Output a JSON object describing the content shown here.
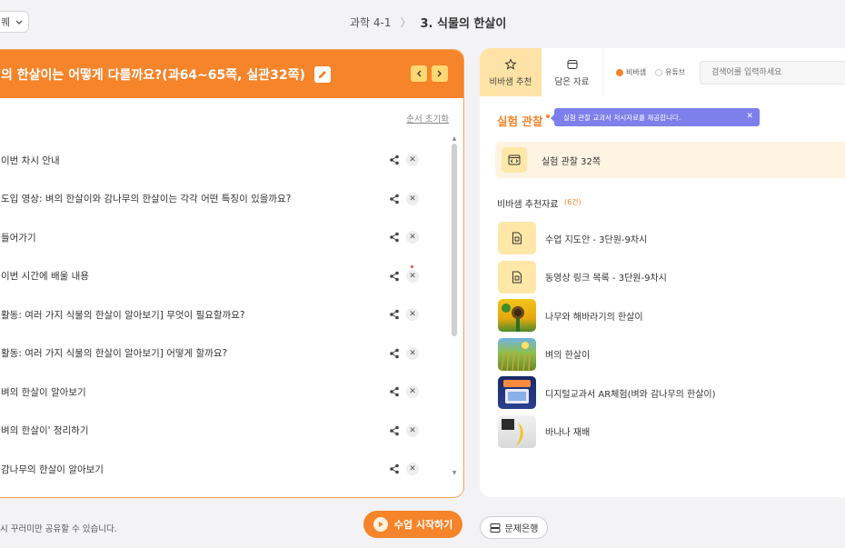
{
  "topbar": {
    "dropdown_label": "퀘",
    "breadcrumb_subject": "과학 4-1",
    "breadcrumb_current": "3. 식물의 한살이"
  },
  "lesson": {
    "title": "의 한살이는 어떻게 다를까요?(과64~65쪽, 실관32쪽)",
    "reset_label": "순서 초기화",
    "items": [
      "이번 차시 안내",
      "도입 영상: 벼의 한살이와 감나무의 한살이는 각각 어떤 특징이 있을까요?",
      "들어가기",
      "이번 시간에 배울 내용",
      "활동: 여러 가지 식물의 한살이 알아보기] 무엇이 필요할까요?",
      "활동: 여러 가지 식물의 한살이 알아보기] 어떻게 할까요?",
      "벼의 한살이 알아보기",
      "벼의 한살이' 정리하기",
      "감나무의 한살이 알아보기"
    ]
  },
  "bottom": {
    "note": "시 꾸러미만 공유할 수 있습니다.",
    "start_label": "수업 시작하기",
    "question_bank_label": "문제은행"
  },
  "right": {
    "tabs": [
      {
        "label": "비바샘 추천",
        "icon": "star-icon"
      },
      {
        "label": "담은 자료",
        "icon": "folder-icon"
      }
    ],
    "radio_vivasam": "비바샘",
    "radio_youtube": "유튜브",
    "search_placeholder": "검색어를 입력하세요",
    "section_title": "실험 관찰",
    "tooltip": "실험 관찰 교과서 저시자료를 제공합니다.",
    "experiment_item": "실험 관찰 32쪽",
    "rec_title": "비바샘 추천자료",
    "rec_count": "(6건)",
    "rec_items": [
      {
        "label": "수업 지도안 - 3단원-9차시",
        "type": "doc"
      },
      {
        "label": "동영상 링크 목록 - 3단원-9차시",
        "type": "doc"
      },
      {
        "label": "나무와 해바라기의 한살이",
        "type": "image"
      },
      {
        "label": "벼의 한살이",
        "type": "image"
      },
      {
        "label": "디지털교과서 AR체험(벼와 감나무의 한살이)",
        "type": "image"
      },
      {
        "label": "바나나 재배",
        "type": "image"
      }
    ]
  },
  "colors": {
    "accent": "#f5842a",
    "tab_active": "#ffe3a6",
    "tooltip": "#7d7fea"
  }
}
